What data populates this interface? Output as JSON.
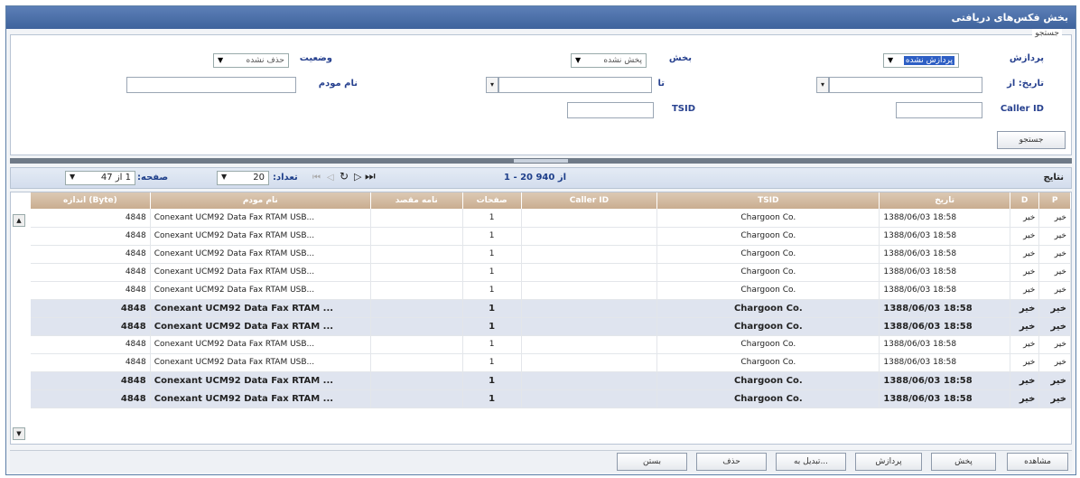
{
  "window": {
    "title": "بخش فکس‌های دریافتی"
  },
  "search": {
    "legend": "جستجو",
    "processing_label": "پردازش",
    "processing_value": "پردازش نشده",
    "section_label": "بخش",
    "section_value": "پخش نشده",
    "status_label": "وضعیت",
    "status_value": "حذف نشده",
    "date_from_label": "تاریخ: از",
    "to_label": "تا",
    "modem_label": "نام مودم",
    "callerid_label": "Caller ID",
    "tsid_label": "TSID",
    "search_button": "جستجو"
  },
  "pager": {
    "results_label": "نتایج",
    "range": "1 - 20 از 940",
    "count_label": "تعداد:",
    "count_value": "20",
    "page_label": "صفحه:",
    "page_value": "1 از 47"
  },
  "columns": {
    "p": "P",
    "d": "D",
    "date": "تاریخ",
    "tsid": "TSID",
    "callerid": "Caller ID",
    "pages": "صفحات",
    "dest": "نامه مقصد",
    "modem": "نام مودم",
    "size": "اندازه (Byte)"
  },
  "rows": [
    {
      "p": "خیر",
      "d": "خیر",
      "date": "1388/06/03 18:58",
      "tsid": "Chargoon Co.",
      "callerid": "",
      "pages": "1",
      "dest": "",
      "modem": "Conexant UCM92 Data Fax RTAM USB...",
      "size": "4848",
      "bold": false
    },
    {
      "p": "خیر",
      "d": "خیر",
      "date": "1388/06/03 18:58",
      "tsid": "Chargoon Co.",
      "callerid": "",
      "pages": "1",
      "dest": "",
      "modem": "Conexant UCM92 Data Fax RTAM USB...",
      "size": "4848",
      "bold": false
    },
    {
      "p": "خیر",
      "d": "خیر",
      "date": "1388/06/03 18:58",
      "tsid": "Chargoon Co.",
      "callerid": "",
      "pages": "1",
      "dest": "",
      "modem": "Conexant UCM92 Data Fax RTAM USB...",
      "size": "4848",
      "bold": false
    },
    {
      "p": "خیر",
      "d": "خیر",
      "date": "1388/06/03 18:58",
      "tsid": "Chargoon Co.",
      "callerid": "",
      "pages": "1",
      "dest": "",
      "modem": "Conexant UCM92 Data Fax RTAM USB...",
      "size": "4848",
      "bold": false
    },
    {
      "p": "خیر",
      "d": "خیر",
      "date": "1388/06/03 18:58",
      "tsid": "Chargoon Co.",
      "callerid": "",
      "pages": "1",
      "dest": "",
      "modem": "Conexant UCM92 Data Fax RTAM USB...",
      "size": "4848",
      "bold": false
    },
    {
      "p": "خیر",
      "d": "خیر",
      "date": "1388/06/03 18:58",
      "tsid": "Chargoon Co.",
      "callerid": "",
      "pages": "1",
      "dest": "",
      "modem": "Conexant UCM92 Data Fax RTAM ...",
      "size": "4848",
      "bold": true
    },
    {
      "p": "خیر",
      "d": "خیر",
      "date": "1388/06/03 18:58",
      "tsid": "Chargoon Co.",
      "callerid": "",
      "pages": "1",
      "dest": "",
      "modem": "Conexant UCM92 Data Fax RTAM ...",
      "size": "4848",
      "bold": true
    },
    {
      "p": "خیر",
      "d": "خیر",
      "date": "1388/06/03 18:58",
      "tsid": "Chargoon Co.",
      "callerid": "",
      "pages": "1",
      "dest": "",
      "modem": "Conexant UCM92 Data Fax RTAM USB...",
      "size": "4848",
      "bold": false
    },
    {
      "p": "خیر",
      "d": "خیر",
      "date": "1388/06/03 18:58",
      "tsid": "Chargoon Co.",
      "callerid": "",
      "pages": "1",
      "dest": "",
      "modem": "Conexant UCM92 Data Fax RTAM USB...",
      "size": "4848",
      "bold": false
    },
    {
      "p": "خیر",
      "d": "خیر",
      "date": "1388/06/03 18:58",
      "tsid": "Chargoon Co.",
      "callerid": "",
      "pages": "1",
      "dest": "",
      "modem": "Conexant UCM92 Data Fax RTAM ...",
      "size": "4848",
      "bold": true
    },
    {
      "p": "خیر",
      "d": "خیر",
      "date": "1388/06/03 18:58",
      "tsid": "Chargoon Co.",
      "callerid": "",
      "pages": "1",
      "dest": "",
      "modem": "Conexant UCM92 Data Fax RTAM ...",
      "size": "4848",
      "bold": true
    }
  ],
  "actions": {
    "view": "مشاهده",
    "distribute": "پخش",
    "process": "پردازش",
    "convert": "تبدیل به...",
    "delete": "حذف",
    "close": "بستن"
  }
}
